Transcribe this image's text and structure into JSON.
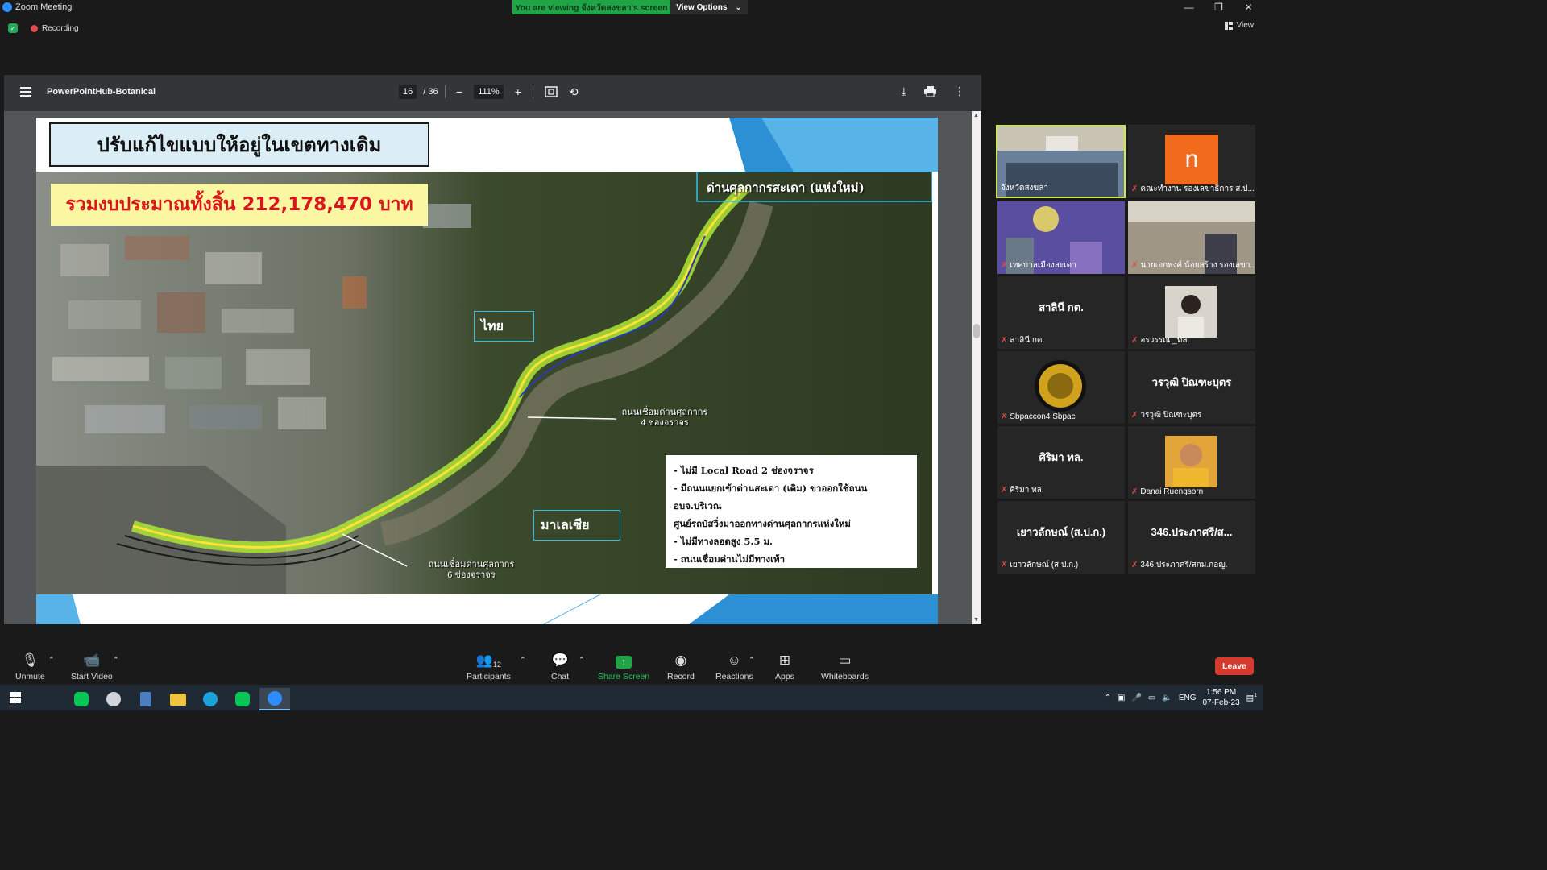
{
  "window": {
    "app_title": "Zoom Meeting",
    "viewing_banner": "You are viewing จังหวัดสงขลา's screen",
    "view_options": "View Options",
    "recording": "Recording",
    "view": "View",
    "controls": {
      "minimize": "—",
      "restore": "❐",
      "close": "✕"
    }
  },
  "pdf": {
    "doc_title": "PowerPointHub-Botanical",
    "page_current": "16",
    "page_total": "/ 36",
    "zoom_level": "111%",
    "zoom_minus": "−",
    "zoom_plus": "+"
  },
  "slide": {
    "title": "ปรับแก้ไขแบบให้อยู่ในเขตทางเดิม",
    "budget": "รวมงบประมาณทั้งสิ้น 212,178,470 บาท",
    "customs_label": "ด่านศุลกากรสะเดา (แห่งใหม่)",
    "thailand": "ไทย",
    "malaysia": "มาเลเซีย",
    "road_4_lanes": [
      "ถนนเชื่อมด่านศุลกากร",
      "4 ช่องจราจร"
    ],
    "road_6_lanes": [
      "ถนนเชื่อมด่านศุลกากร",
      "6 ช่องจราจร"
    ],
    "notes": [
      "- ไม่มี Local Road 2 ช่องจราจร",
      "- มีถนนแยกเข้าด่านสะเดา (เดิม) ขาออกใช้ถนนอบจ.บริเวณ",
      "ศูนย์รถบัสวิ่งมาออกทางด่านศุลกากรแห่งใหม่",
      "- ไม่มีทางลอดสูง 5.5 ม.",
      "- ถนนเชื่อมด่านไม่มีทางเท้า"
    ]
  },
  "participants_gallery": [
    {
      "name": "จังหวัดสงขลา",
      "type": "video",
      "active": true
    },
    {
      "name": "คณะทำงาน รองเลขาธิการ ส.ป...",
      "type": "avatar",
      "avatar_letter": "n"
    },
    {
      "name": "เทศบาลเมืองสะเดา",
      "type": "video"
    },
    {
      "name": "นายเอกพงศ์ น้อยสร้าง รองเลขา...",
      "type": "video"
    },
    {
      "name": "สาลินี กต.",
      "type": "name",
      "center": "สาลินี กต."
    },
    {
      "name": "อรวรรณ _ทล.",
      "type": "photo"
    },
    {
      "name": "Sbpaccon4 Sbpac",
      "type": "emblem"
    },
    {
      "name": "วรวุฒิ ปิณฑะบุตร",
      "type": "name",
      "center": "วรวุฒิ ปิณฑะบุตร"
    },
    {
      "name": "ศิริมา ทล.",
      "type": "name",
      "center": "ศิริมา ทล."
    },
    {
      "name": "Danai Ruengsorn",
      "type": "photo"
    },
    {
      "name": "เยาวลักษณ์ (ส.ป.ก.)",
      "type": "name",
      "center": "เยาวลักษณ์ (ส.ป.ก.)"
    },
    {
      "name": "346.ประภาศรี/สกม.กอญ.",
      "type": "name",
      "center": "346.ประภาศรี/ส..."
    }
  ],
  "meeting_controls": {
    "unmute": "Unmute",
    "start_video": "Start Video",
    "participants": "Participants",
    "participants_count": "12",
    "chat": "Chat",
    "share_screen": "Share Screen",
    "record": "Record",
    "reactions": "Reactions",
    "apps": "Apps",
    "whiteboards": "Whiteboards",
    "leave": "Leave"
  },
  "taskbar": {
    "language": "ENG",
    "time": "1:56 PM",
    "date": "07-Feb-23",
    "notification_count": "1"
  },
  "colors": {
    "zoom_green": "#21a348",
    "leave_red": "#d53a2e",
    "budget_red": "#d8161b",
    "budget_bg": "#fbf6a1",
    "title_bg": "#dbeef6",
    "deco_blue": "#2d8fd4"
  }
}
